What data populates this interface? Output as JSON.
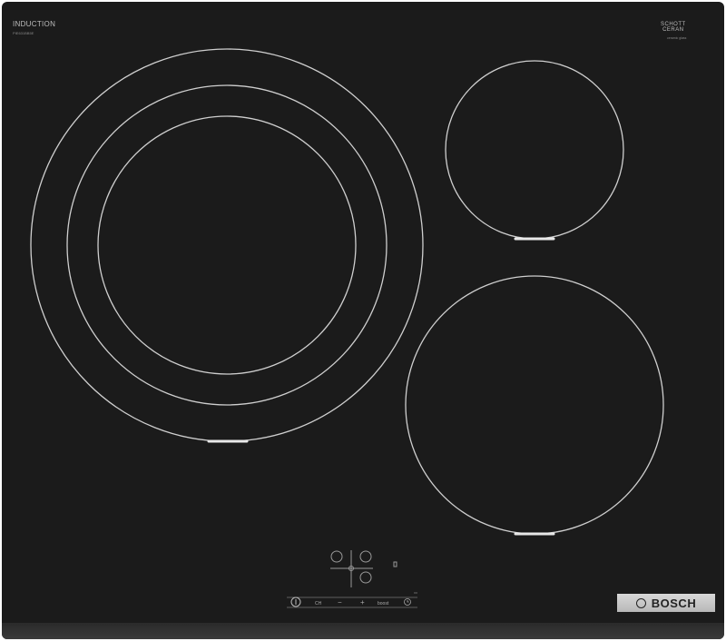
{
  "product": {
    "type_label": "INDUCTION",
    "model_code": "PIE631BB5E",
    "glass_brand_line1": "SCHOTT",
    "glass_brand_line2": "CERAN",
    "glass_sub": "ceramic glass",
    "brand": "BOSCH"
  },
  "controls": {
    "power_icon": "power-icon",
    "combi_label": "CH",
    "minus_label": "−",
    "plus_label": "+",
    "boost_label": "boost",
    "timer_icon": "clock-icon"
  },
  "colors": {
    "glass": "#1b1b1b",
    "lines": "#c8c8c8",
    "badge": "#c8c8c8"
  }
}
